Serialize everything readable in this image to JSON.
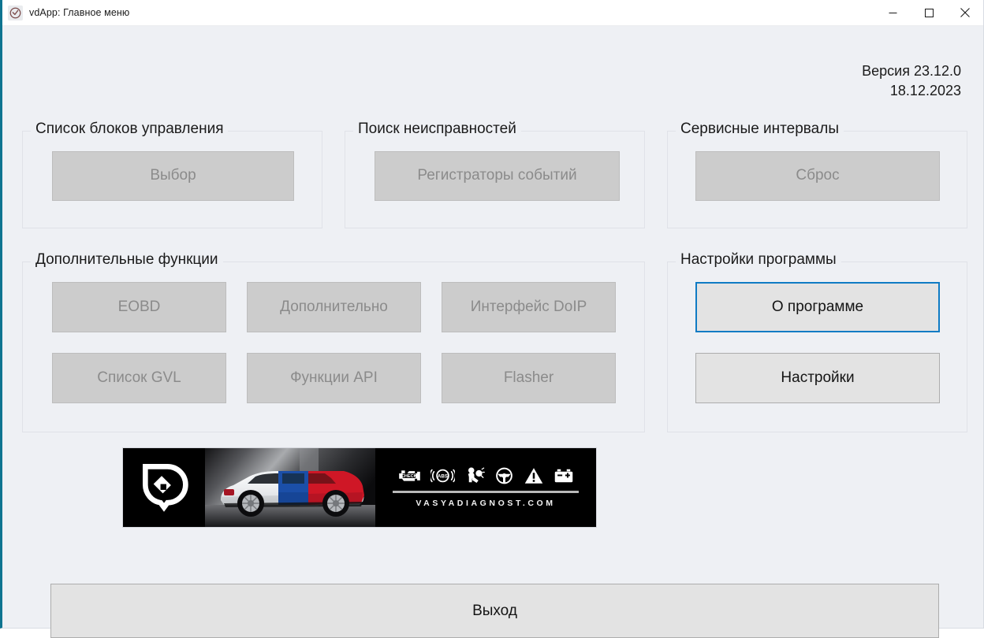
{
  "window": {
    "icon": "vd-logo-icon",
    "title": "vdApp:  Главное меню",
    "controls": {
      "minimize": "minimize-icon",
      "maximize": "maximize-icon",
      "close": "close-icon"
    }
  },
  "version": {
    "label": "Версия 23.12.0",
    "date": "18.12.2023"
  },
  "groups": {
    "ecu_list": {
      "title": "Список блоков управления",
      "buttons": [
        {
          "label": "Выбор",
          "state": "disabled"
        }
      ]
    },
    "fault_search": {
      "title": "Поиск неисправностей",
      "buttons": [
        {
          "label": "Регистраторы событий",
          "state": "disabled"
        }
      ]
    },
    "service_intervals": {
      "title": "Сервисные интервалы",
      "buttons": [
        {
          "label": "Сброс",
          "state": "disabled"
        }
      ]
    },
    "extra_functions": {
      "title": "Дополнительные функции",
      "buttons": [
        {
          "label": "EOBD",
          "state": "disabled"
        },
        {
          "label": "Дополнительно",
          "state": "disabled"
        },
        {
          "label": "Интерфейс DoIP",
          "state": "disabled"
        },
        {
          "label": "Список GVL",
          "state": "disabled"
        },
        {
          "label": "Функции API",
          "state": "disabled"
        },
        {
          "label": "Flasher",
          "state": "disabled"
        }
      ]
    },
    "program_settings": {
      "title": "Настройки программы",
      "buttons": [
        {
          "label": "О программе",
          "state": "focused"
        },
        {
          "label": "Настройки",
          "state": "enabled"
        }
      ]
    }
  },
  "banner": {
    "url_text": "VASYADIAGNOST.COM",
    "logo": "vasya-diagnost-logo-icon",
    "car": "skoda-car-photo",
    "warning_icons": [
      "check-engine-icon",
      "abs-icon",
      "airbag-icon",
      "steering-icon",
      "warning-triangle-icon",
      "battery-icon"
    ],
    "check_engine_text": "CHECK",
    "abs_text": "ABS"
  },
  "exit": {
    "label": "Выход"
  },
  "colors": {
    "window_background": "#eef0f4",
    "accent_border": "#0e7490",
    "focus_border": "#0f7bc4",
    "button_enabled": "#e3e3e3",
    "button_disabled": "#cccccc",
    "disabled_text": "#8b8b8b",
    "banner_background": "#000000",
    "car_blue": "#1b4fa8",
    "car_red": "#cf1726"
  }
}
